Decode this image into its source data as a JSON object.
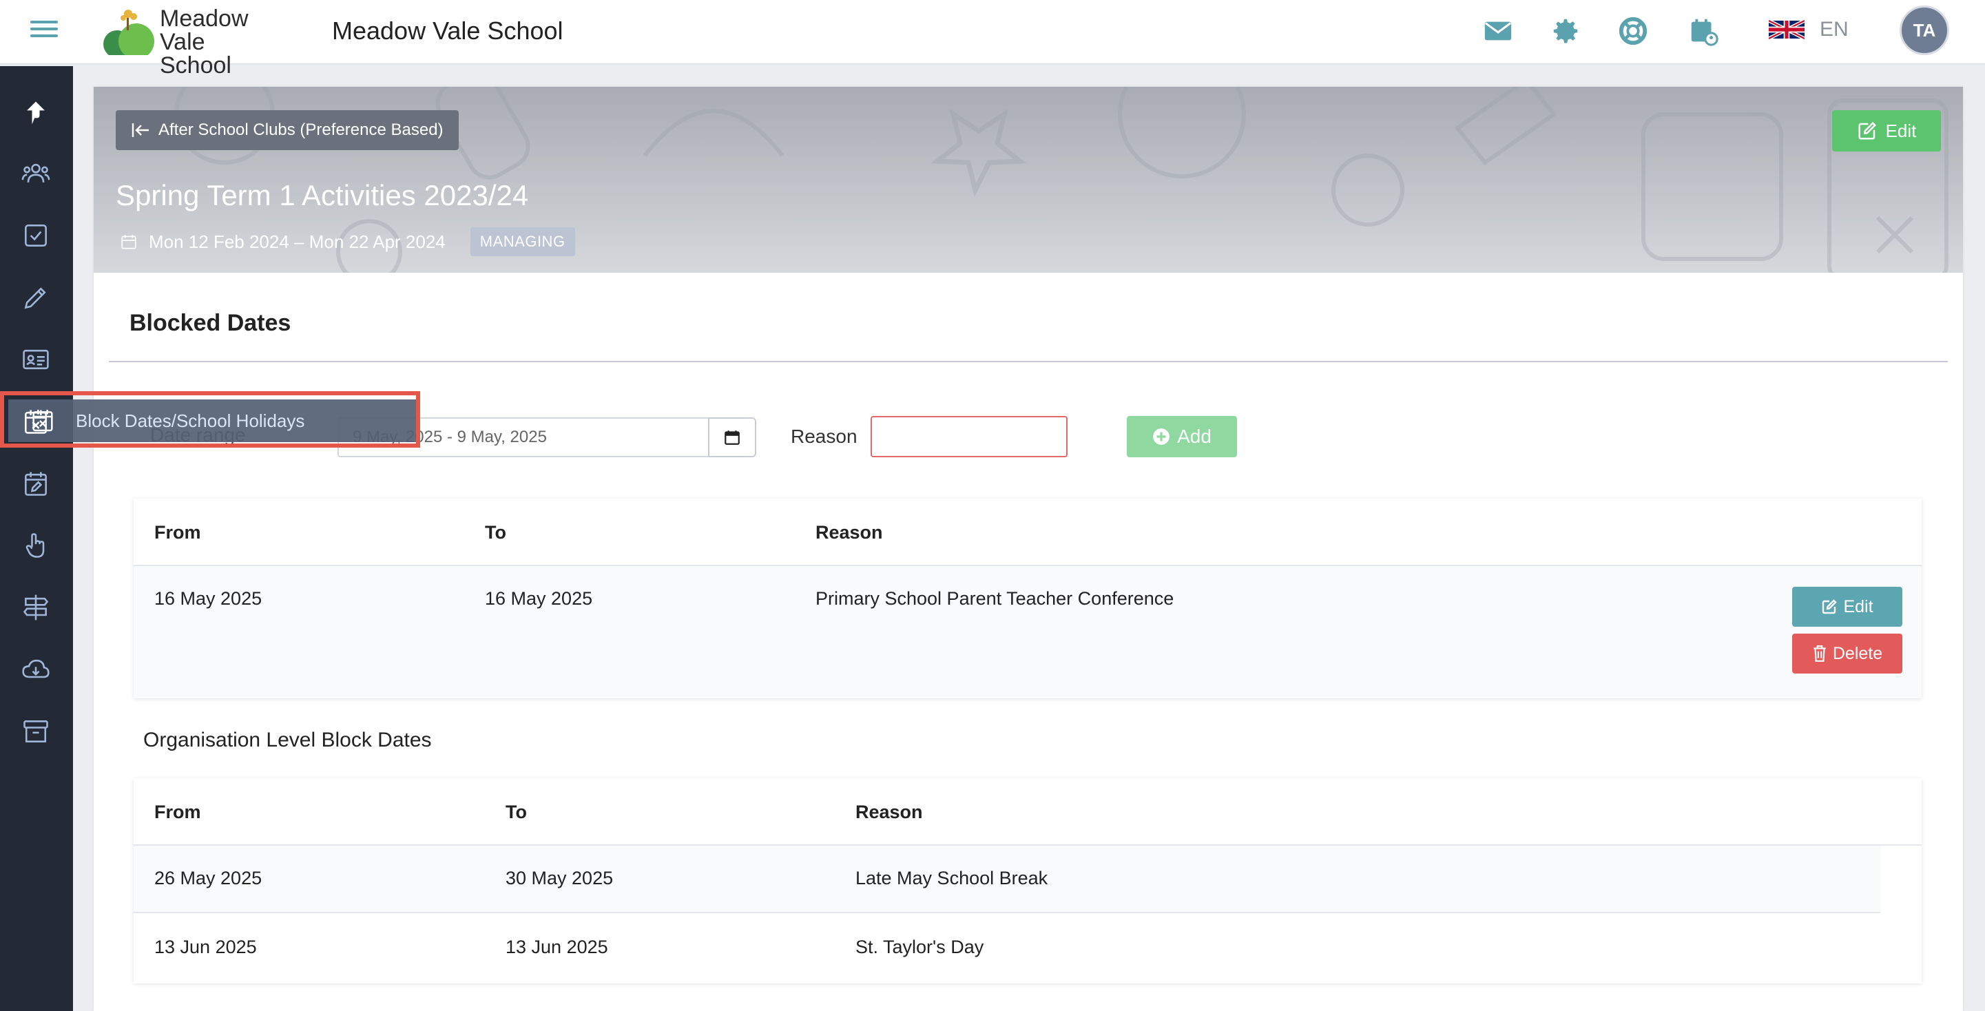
{
  "header": {
    "logo_text_line1": "Meadow",
    "logo_text_line2": "Vale School",
    "school_name": "Meadow Vale School",
    "language": "EN",
    "avatar_initials": "TA",
    "icons": [
      "envelope-icon",
      "gear-icon",
      "lifebuoy-icon",
      "calendar-user-icon",
      "uk-flag-icon"
    ]
  },
  "sidebar": {
    "items": [
      {
        "icon": "arrow-up-icon"
      },
      {
        "icon": "users-icon"
      },
      {
        "icon": "checkbox-icon"
      },
      {
        "icon": "pencil-icon"
      },
      {
        "icon": "id-card-icon"
      },
      {
        "icon": "calendar-x-icon"
      },
      {
        "icon": "calendar-edit-icon"
      },
      {
        "icon": "hand-pointer-icon"
      },
      {
        "icon": "signpost-icon"
      },
      {
        "icon": "cloud-download-icon"
      },
      {
        "icon": "archive-icon"
      }
    ],
    "tooltip": "Block Dates/School Holidays"
  },
  "banner": {
    "back_label": "After School Clubs (Preference Based)",
    "edit_label": "Edit",
    "title": "Spring Term 1 Activities 2023/24",
    "dates": "Mon 12 Feb 2024 – Mon 22 Apr 2024",
    "status_badge": "MANAGING"
  },
  "blocked_dates": {
    "title": "Blocked Dates",
    "date_range_label": "Date range",
    "date_range_value": "9 May, 2025 - 9 May, 2025",
    "reason_label": "Reason",
    "reason_value": "",
    "add_label": "Add",
    "columns": [
      "From",
      "To",
      "Reason"
    ],
    "rows": [
      {
        "from": "16 May 2025",
        "to": "16 May 2025",
        "reason": "Primary School Parent Teacher Conference"
      }
    ],
    "edit_label": "Edit",
    "delete_label": "Delete"
  },
  "org_block_dates": {
    "title": "Organisation Level Block Dates",
    "columns": [
      "From",
      "To",
      "Reason"
    ],
    "rows": [
      {
        "from": "26 May 2025",
        "to": "30 May 2025",
        "reason": "Late May School Break"
      },
      {
        "from": "13 Jun 2025",
        "to": "13 Jun 2025",
        "reason": "St. Taylor's Day"
      }
    ]
  },
  "colors": {
    "accent": "#5aa2ad",
    "sidebar_bg": "#232a36",
    "success": "#5cc46f",
    "danger": "#e35a5a",
    "highlight": "#e4574a"
  }
}
